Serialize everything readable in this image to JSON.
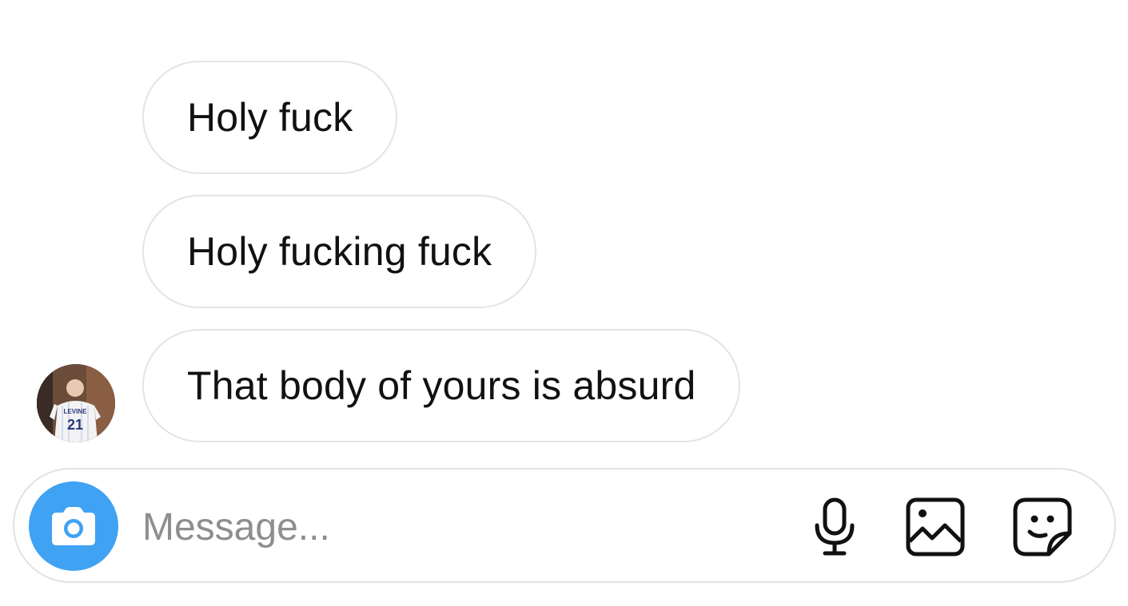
{
  "messages": [
    {
      "text": "Holy fuck"
    },
    {
      "text": "Holy fucking fuck"
    },
    {
      "text": "That body of yours is absurd"
    }
  ],
  "sender": {
    "avatar_jersey_name": "LEVINE",
    "avatar_jersey_number": "21"
  },
  "composer": {
    "placeholder": "Message...",
    "icons": {
      "camera": "camera-icon",
      "microphone": "microphone-icon",
      "gallery": "gallery-icon",
      "sticker": "sticker-icon"
    }
  },
  "colors": {
    "camera_button": "#3fa2f3",
    "bubble_border": "#e4e4e4",
    "placeholder": "#8e8e8e",
    "icon": "#111111"
  }
}
